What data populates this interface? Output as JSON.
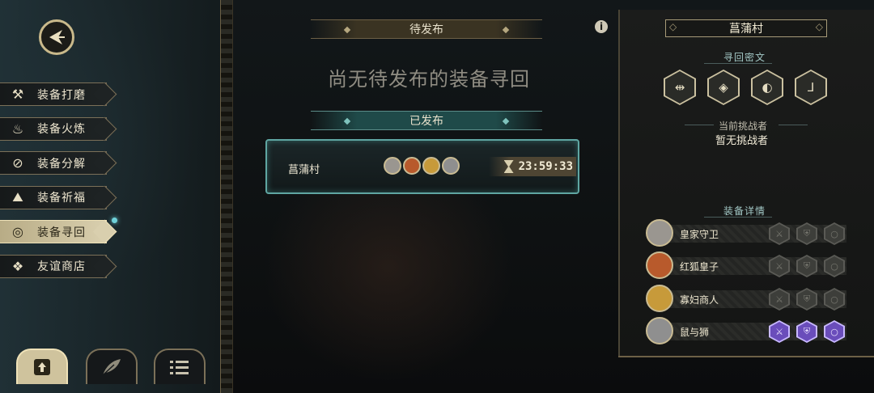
{
  "menu": {
    "items": [
      {
        "label": "装备打磨",
        "icon": "hammer-icon",
        "glyph": "⚒"
      },
      {
        "label": "装备火炼",
        "icon": "flame-icon",
        "glyph": "♨"
      },
      {
        "label": "装备分解",
        "icon": "split-icon",
        "glyph": "⊘"
      },
      {
        "label": "装备祈福",
        "icon": "prayer-icon",
        "glyph": "⛰"
      },
      {
        "label": "装备寻回",
        "icon": "target-icon",
        "glyph": "◎"
      },
      {
        "label": "友谊商店",
        "icon": "fox-icon",
        "glyph": "❖"
      }
    ]
  },
  "center": {
    "pending_label": "待发布",
    "empty_message": "尚无待发布的装备寻回",
    "published_label": "已发布",
    "entry": {
      "name": "菖蒲村",
      "timer": "23:59:33"
    }
  },
  "right": {
    "village": "菖蒲村",
    "cipher_title": "寻回密文",
    "challenger_label": "当前挑战者",
    "challenger_value": "暂无挑战者",
    "details_title": "装备详情",
    "heroes": [
      {
        "name": "皇家守卫",
        "color": "#9a9690"
      },
      {
        "name": "红狐皇子",
        "color": "#b85a2c"
      },
      {
        "name": "寡妇商人",
        "color": "#c79a3a"
      },
      {
        "name": "鼠与狮",
        "color": "#8f8f8f"
      }
    ]
  }
}
